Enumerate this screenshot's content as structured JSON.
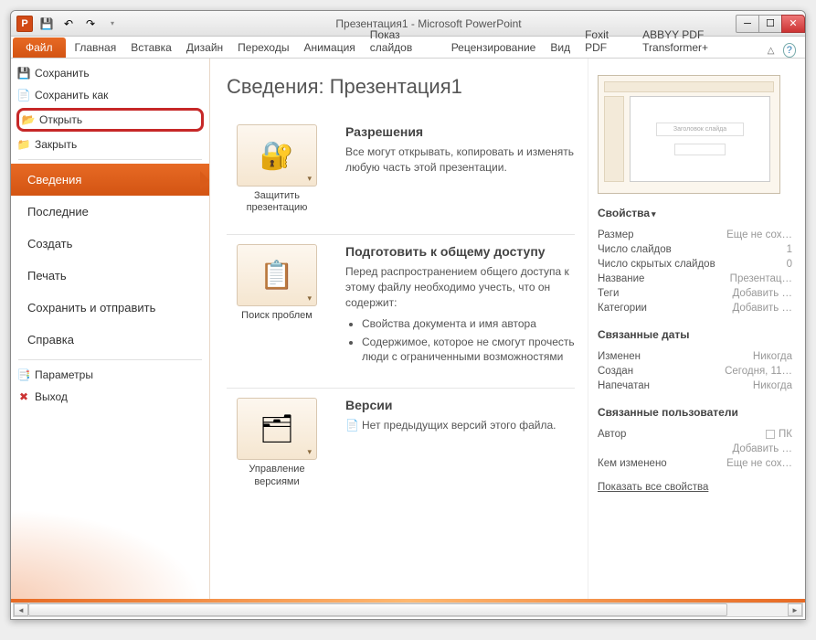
{
  "title": "Презентация1 - Microsoft PowerPoint",
  "ribbon": {
    "file": "Файл",
    "tabs": [
      "Главная",
      "Вставка",
      "Дизайн",
      "Переходы",
      "Анимация",
      "Показ слайдов",
      "Рецензирование",
      "Вид",
      "Foxit PDF",
      "ABBYY PDF Transformer+"
    ]
  },
  "nav": {
    "save": "Сохранить",
    "save_as": "Сохранить как",
    "open": "Открыть",
    "close": "Закрыть",
    "info": "Сведения",
    "recent": "Последние",
    "new": "Создать",
    "print": "Печать",
    "share": "Сохранить и отправить",
    "help": "Справка",
    "options": "Параметры",
    "exit": "Выход"
  },
  "main": {
    "heading": "Сведения: Презентация1",
    "protect": {
      "btn": "Защитить презентацию",
      "title": "Разрешения",
      "body": "Все могут открывать, копировать и изменять любую часть этой презентации."
    },
    "prepare": {
      "btn": "Поиск проблем",
      "title": "Подготовить к общему доступу",
      "body": "Перед распространением общего доступа к этому файлу необходимо учесть, что он содержит:",
      "li1": "Свойства документа и имя автора",
      "li2": "Содержимое, которое не смогут прочесть люди с ограниченными возможностями"
    },
    "versions": {
      "btn": "Управление версиями",
      "title": "Версии",
      "body": "Нет предыдущих версий этого файла."
    }
  },
  "right": {
    "thumb_title": "Заголовок слайда",
    "props_head": "Свойства",
    "size_k": "Размер",
    "size_v": "Еще не сох…",
    "slides_k": "Число слайдов",
    "slides_v": "1",
    "hidden_k": "Число скрытых слайдов",
    "hidden_v": "0",
    "title_k": "Название",
    "title_v": "Презентац…",
    "tags_k": "Теги",
    "tags_v": "Добавить …",
    "cats_k": "Категории",
    "cats_v": "Добавить …",
    "dates_head": "Связанные даты",
    "mod_k": "Изменен",
    "mod_v": "Никогда",
    "created_k": "Создан",
    "created_v": "Сегодня, 11…",
    "printed_k": "Напечатан",
    "printed_v": "Никогда",
    "users_head": "Связанные пользователи",
    "author_k": "Автор",
    "author_v": "ПК",
    "author_add": "Добавить …",
    "changedby_k": "Кем изменено",
    "changedby_v": "Еще не сох…",
    "show_all": "Показать все свойства"
  }
}
